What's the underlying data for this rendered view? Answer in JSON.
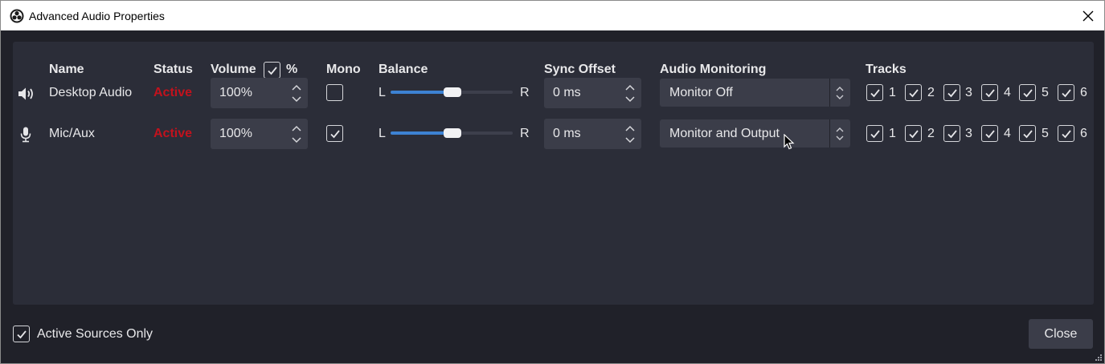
{
  "window": {
    "title": "Advanced Audio Properties"
  },
  "columns": {
    "name": "Name",
    "status": "Status",
    "volume": "Volume",
    "volume_percent": "%",
    "mono": "Mono",
    "balance": "Balance",
    "sync_offset": "Sync Offset",
    "audio_monitoring": "Audio Monitoring",
    "tracks": "Tracks"
  },
  "volume_percent_checked": true,
  "rows": [
    {
      "icon": "speaker-icon",
      "name": "Desktop Audio",
      "status": "Active",
      "volume": "100%",
      "mono": false,
      "balance_left": "L",
      "balance_right": "R",
      "balance_value": 0.5,
      "sync_offset": "0 ms",
      "monitoring": "Monitor Off",
      "tracks": [
        {
          "label": "1",
          "checked": true
        },
        {
          "label": "2",
          "checked": true
        },
        {
          "label": "3",
          "checked": true
        },
        {
          "label": "4",
          "checked": true
        },
        {
          "label": "5",
          "checked": true
        },
        {
          "label": "6",
          "checked": true
        }
      ]
    },
    {
      "icon": "microphone-icon",
      "name": "Mic/Aux",
      "status": "Active",
      "volume": "100%",
      "mono": true,
      "balance_left": "L",
      "balance_right": "R",
      "balance_value": 0.5,
      "sync_offset": "0 ms",
      "monitoring": "Monitor and Output",
      "tracks": [
        {
          "label": "1",
          "checked": true
        },
        {
          "label": "2",
          "checked": true
        },
        {
          "label": "3",
          "checked": true
        },
        {
          "label": "4",
          "checked": true
        },
        {
          "label": "5",
          "checked": true
        },
        {
          "label": "6",
          "checked": true
        }
      ]
    }
  ],
  "footer": {
    "active_sources_only_label": "Active Sources Only",
    "active_sources_only_checked": true,
    "close_label": "Close"
  },
  "colors": {
    "status_active": "#c2121d",
    "slider_fill": "#3d82d3",
    "dialog_bg": "#202129",
    "panel_bg": "#2b2d38"
  }
}
